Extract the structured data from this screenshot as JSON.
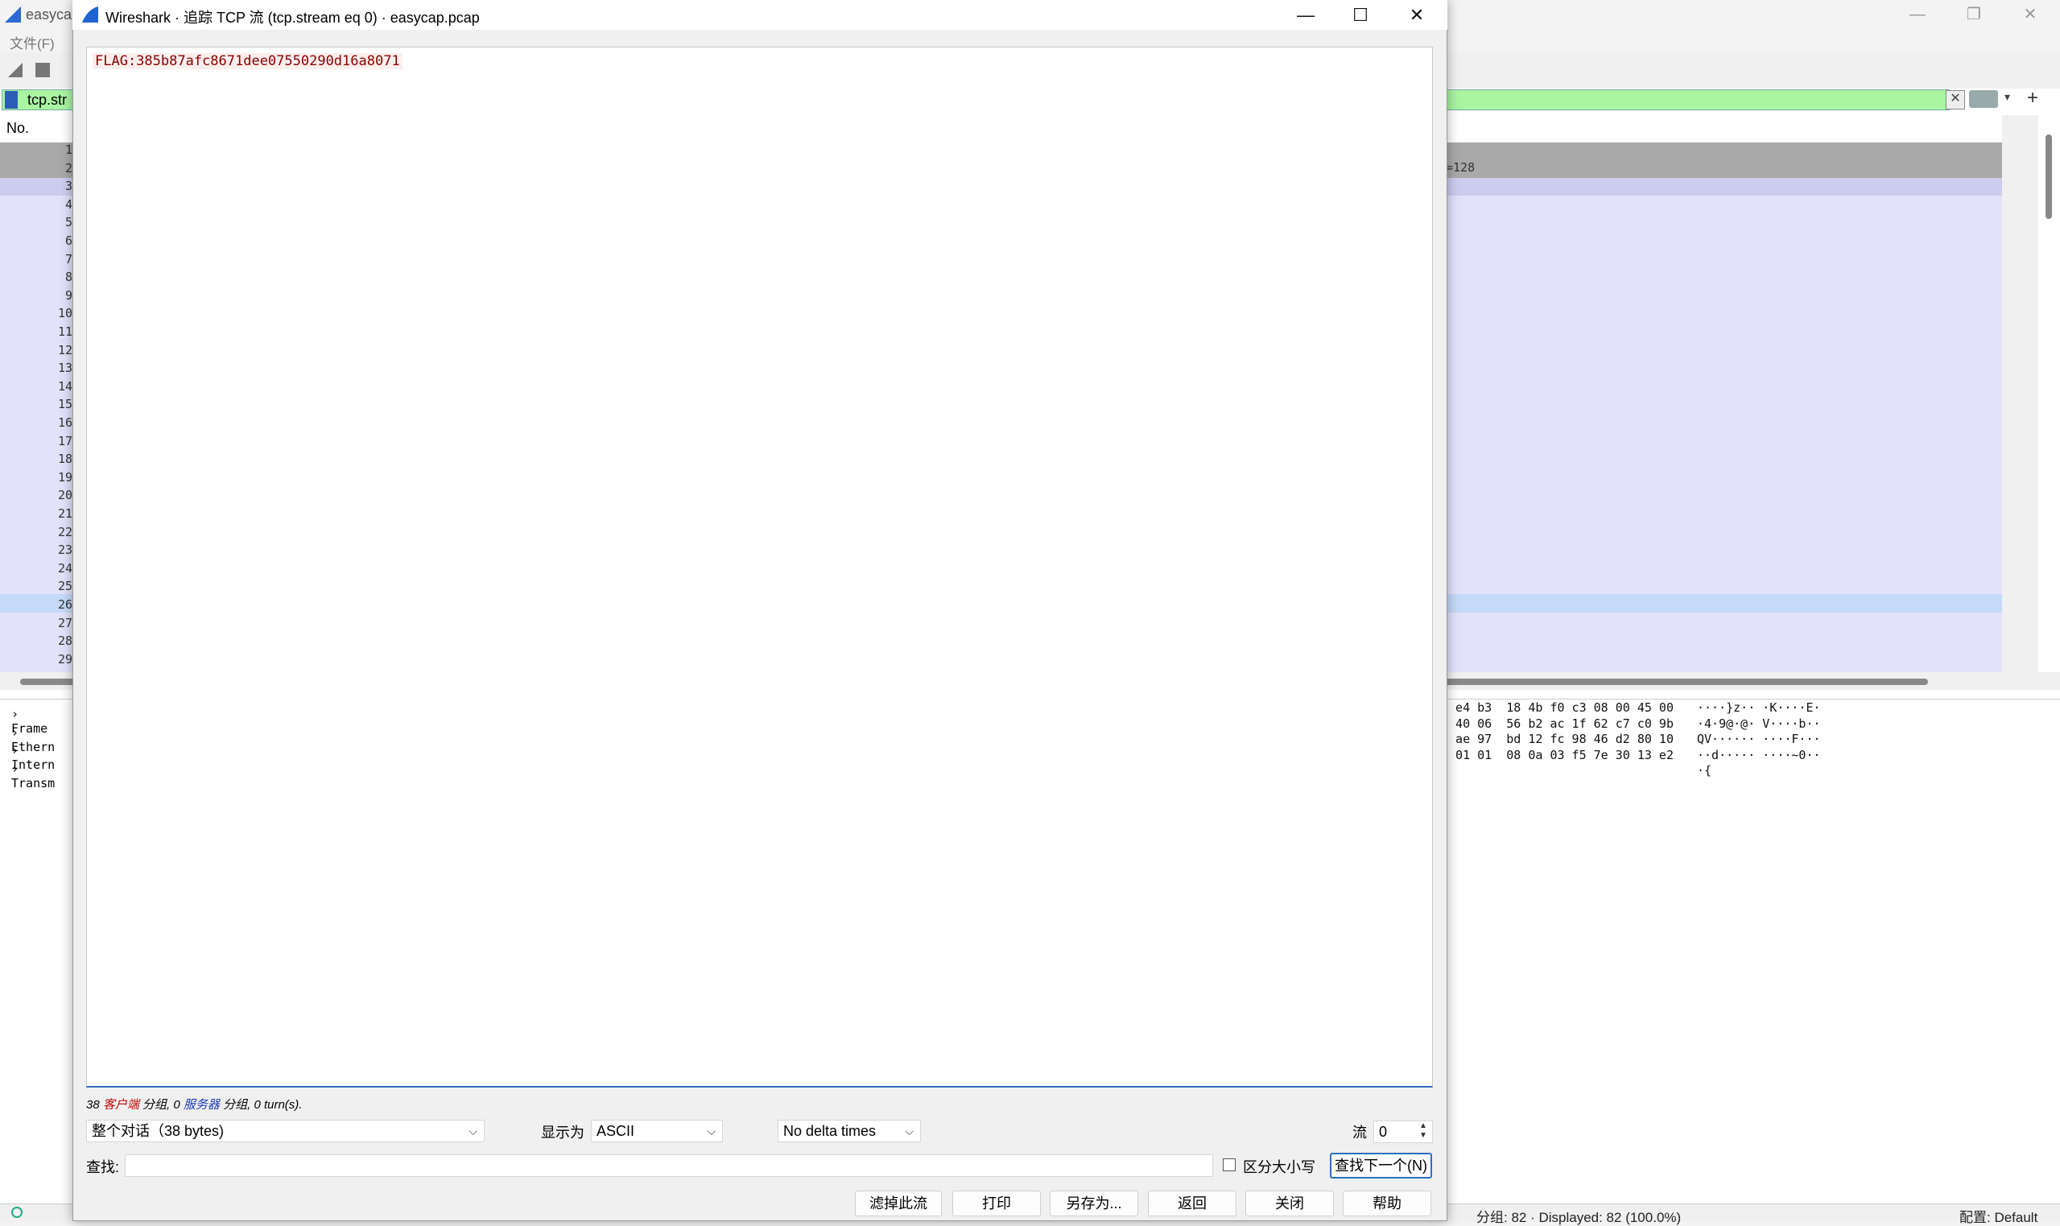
{
  "background": {
    "title": "easycap",
    "menu_file": "文件(F)",
    "filter_text": "tcp.str",
    "column_no": "No.",
    "row_info": "=128",
    "row_numbers": [
      "1",
      "2",
      "3",
      "4",
      "5",
      "6",
      "7",
      "8",
      "9",
      "10",
      "11",
      "12",
      "13",
      "14",
      "15",
      "16",
      "17",
      "18",
      "19",
      "20",
      "21",
      "22",
      "23",
      "24",
      "25",
      "26",
      "27",
      "28",
      "29"
    ],
    "tree_items": [
      "Frame",
      "Ethern",
      "Intern",
      "Transm"
    ],
    "hex_lines": [
      "  e4 b3  18 4b f0 c3 08 00 45 00",
      "  40 06  56 b2 ac 1f 62 c7 c0 9b",
      "  ae 97  bd 12 fc 98 46 d2 80 10",
      "  01 01  08 0a 03 f5 7e 30 13 e2"
    ],
    "ascii_lines": [
      "····}z·· ·K····E·",
      "·4·9@·@· V····b··",
      "QV······ ····F···",
      "··d····· ····~0··",
      "·{"
    ],
    "status_packets": "分组: 82 · Displayed: 82 (100.0%)",
    "status_profile": "配置: Default"
  },
  "dialog": {
    "title": "Wireshark · 追踪 TCP 流 (tcp.stream eq 0) · easycap.pcap",
    "stream_content": "FLAG:385b87afc8671dee07550290d16a8071",
    "summary": {
      "client_count": "38",
      "client_label": "客户端",
      "packets_word": "分组,",
      "server_count": "0",
      "server_label": "服务器",
      "turns": "0 turn(s)."
    },
    "conversation_select": "整个对话（38 bytes)",
    "show_as_label": "显示为",
    "show_as_value": "ASCII",
    "delta_value": "No delta times",
    "stream_label": "流",
    "stream_value": "0",
    "find_label": "查找:",
    "find_value": "",
    "case_label": "区分大小写",
    "find_next_label": "查找下一个(N)",
    "buttons": {
      "filter_out": "滤掉此流",
      "print": "打印",
      "save_as": "另存为...",
      "back": "返回",
      "close": "关闭",
      "help": "帮助"
    }
  },
  "colors": {
    "flag_text": "#8b0000",
    "client_label": "#c00000",
    "server_label": "#1b3bb5",
    "filter_ok": "#a9f5a1",
    "focus_blue": "#2d6fbf"
  }
}
